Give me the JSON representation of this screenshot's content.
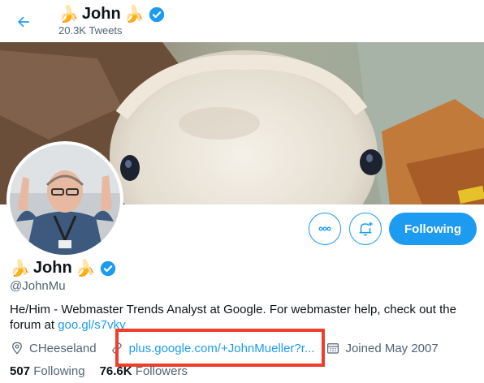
{
  "header": {
    "back_icon": "back-arrow-icon",
    "title_prefix_emoji": "🍌",
    "title": "John",
    "title_suffix_emoji": "🍌",
    "verified_icon": "verified-badge-icon",
    "tweet_count": "20.3K Tweets"
  },
  "profile": {
    "name_prefix_emoji": "🍌",
    "name": "John",
    "name_suffix_emoji": "🍌",
    "handle": "@JohnMu",
    "bio_text": "He/Him - Webmaster Trends Analyst at Google. For webmaster help, check out the forum at ",
    "bio_link": "goo.gl/s7vky",
    "location": "CHeeseland",
    "website": "plus.google.com/+JohnMueller?r...",
    "joined": "Joined May 2007",
    "following_count": "507",
    "following_label": "Following",
    "followers_count": "76.6K",
    "followers_label": "Followers"
  },
  "actions": {
    "more_icon": "more-options-icon",
    "notify_icon": "notification-bell-icon",
    "follow_label": "Following"
  },
  "colors": {
    "accent": "#1d9bf0",
    "highlight": "#f03c2a",
    "secondary_text": "#536471"
  }
}
